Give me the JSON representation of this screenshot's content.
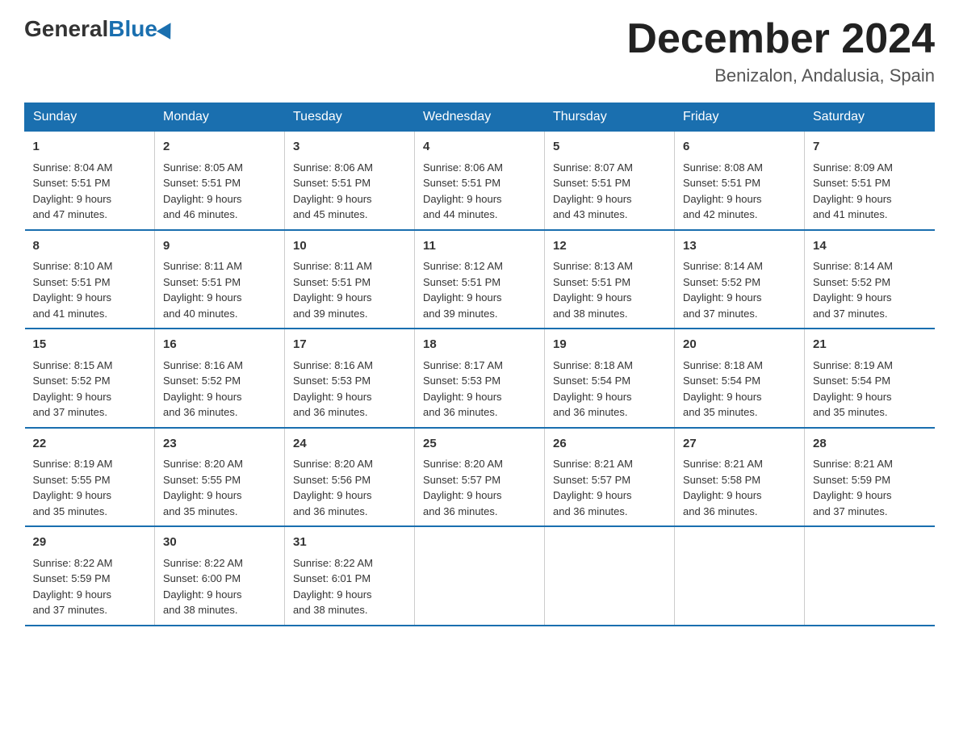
{
  "header": {
    "logo_general": "General",
    "logo_blue": "Blue",
    "month_title": "December 2024",
    "location": "Benizalon, Andalusia, Spain"
  },
  "weekdays": [
    "Sunday",
    "Monday",
    "Tuesday",
    "Wednesday",
    "Thursday",
    "Friday",
    "Saturday"
  ],
  "weeks": [
    [
      {
        "day": "1",
        "sunrise": "8:04 AM",
        "sunset": "5:51 PM",
        "daylight": "9 hours and 47 minutes."
      },
      {
        "day": "2",
        "sunrise": "8:05 AM",
        "sunset": "5:51 PM",
        "daylight": "9 hours and 46 minutes."
      },
      {
        "day": "3",
        "sunrise": "8:06 AM",
        "sunset": "5:51 PM",
        "daylight": "9 hours and 45 minutes."
      },
      {
        "day": "4",
        "sunrise": "8:06 AM",
        "sunset": "5:51 PM",
        "daylight": "9 hours and 44 minutes."
      },
      {
        "day": "5",
        "sunrise": "8:07 AM",
        "sunset": "5:51 PM",
        "daylight": "9 hours and 43 minutes."
      },
      {
        "day": "6",
        "sunrise": "8:08 AM",
        "sunset": "5:51 PM",
        "daylight": "9 hours and 42 minutes."
      },
      {
        "day": "7",
        "sunrise": "8:09 AM",
        "sunset": "5:51 PM",
        "daylight": "9 hours and 41 minutes."
      }
    ],
    [
      {
        "day": "8",
        "sunrise": "8:10 AM",
        "sunset": "5:51 PM",
        "daylight": "9 hours and 41 minutes."
      },
      {
        "day": "9",
        "sunrise": "8:11 AM",
        "sunset": "5:51 PM",
        "daylight": "9 hours and 40 minutes."
      },
      {
        "day": "10",
        "sunrise": "8:11 AM",
        "sunset": "5:51 PM",
        "daylight": "9 hours and 39 minutes."
      },
      {
        "day": "11",
        "sunrise": "8:12 AM",
        "sunset": "5:51 PM",
        "daylight": "9 hours and 39 minutes."
      },
      {
        "day": "12",
        "sunrise": "8:13 AM",
        "sunset": "5:51 PM",
        "daylight": "9 hours and 38 minutes."
      },
      {
        "day": "13",
        "sunrise": "8:14 AM",
        "sunset": "5:52 PM",
        "daylight": "9 hours and 37 minutes."
      },
      {
        "day": "14",
        "sunrise": "8:14 AM",
        "sunset": "5:52 PM",
        "daylight": "9 hours and 37 minutes."
      }
    ],
    [
      {
        "day": "15",
        "sunrise": "8:15 AM",
        "sunset": "5:52 PM",
        "daylight": "9 hours and 37 minutes."
      },
      {
        "day": "16",
        "sunrise": "8:16 AM",
        "sunset": "5:52 PM",
        "daylight": "9 hours and 36 minutes."
      },
      {
        "day": "17",
        "sunrise": "8:16 AM",
        "sunset": "5:53 PM",
        "daylight": "9 hours and 36 minutes."
      },
      {
        "day": "18",
        "sunrise": "8:17 AM",
        "sunset": "5:53 PM",
        "daylight": "9 hours and 36 minutes."
      },
      {
        "day": "19",
        "sunrise": "8:18 AM",
        "sunset": "5:54 PM",
        "daylight": "9 hours and 36 minutes."
      },
      {
        "day": "20",
        "sunrise": "8:18 AM",
        "sunset": "5:54 PM",
        "daylight": "9 hours and 35 minutes."
      },
      {
        "day": "21",
        "sunrise": "8:19 AM",
        "sunset": "5:54 PM",
        "daylight": "9 hours and 35 minutes."
      }
    ],
    [
      {
        "day": "22",
        "sunrise": "8:19 AM",
        "sunset": "5:55 PM",
        "daylight": "9 hours and 35 minutes."
      },
      {
        "day": "23",
        "sunrise": "8:20 AM",
        "sunset": "5:55 PM",
        "daylight": "9 hours and 35 minutes."
      },
      {
        "day": "24",
        "sunrise": "8:20 AM",
        "sunset": "5:56 PM",
        "daylight": "9 hours and 36 minutes."
      },
      {
        "day": "25",
        "sunrise": "8:20 AM",
        "sunset": "5:57 PM",
        "daylight": "9 hours and 36 minutes."
      },
      {
        "day": "26",
        "sunrise": "8:21 AM",
        "sunset": "5:57 PM",
        "daylight": "9 hours and 36 minutes."
      },
      {
        "day": "27",
        "sunrise": "8:21 AM",
        "sunset": "5:58 PM",
        "daylight": "9 hours and 36 minutes."
      },
      {
        "day": "28",
        "sunrise": "8:21 AM",
        "sunset": "5:59 PM",
        "daylight": "9 hours and 37 minutes."
      }
    ],
    [
      {
        "day": "29",
        "sunrise": "8:22 AM",
        "sunset": "5:59 PM",
        "daylight": "9 hours and 37 minutes."
      },
      {
        "day": "30",
        "sunrise": "8:22 AM",
        "sunset": "6:00 PM",
        "daylight": "9 hours and 38 minutes."
      },
      {
        "day": "31",
        "sunrise": "8:22 AM",
        "sunset": "6:01 PM",
        "daylight": "9 hours and 38 minutes."
      },
      null,
      null,
      null,
      null
    ]
  ],
  "labels": {
    "sunrise": "Sunrise:",
    "sunset": "Sunset:",
    "daylight": "Daylight:"
  }
}
